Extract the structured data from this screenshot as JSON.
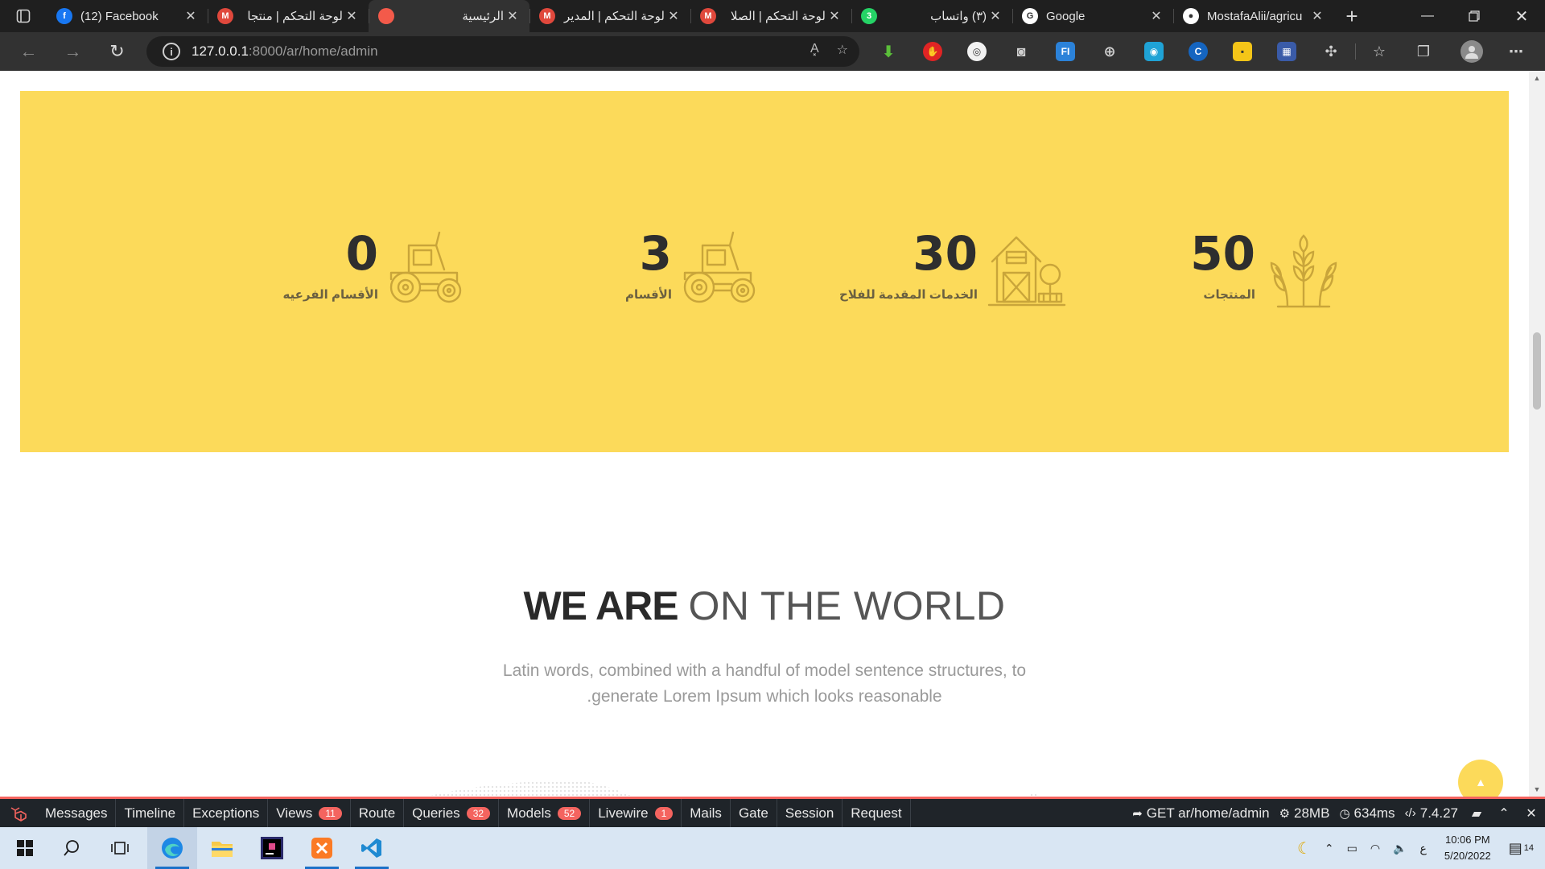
{
  "browser": {
    "tabs": [
      {
        "title": "(12) Facebook",
        "icon": "facebook-icon",
        "rtl": false,
        "active": false,
        "color": "#1877f2",
        "glyph": "f"
      },
      {
        "title": "لوحة التحكم | منتجا",
        "icon": "m-logo-icon",
        "rtl": true,
        "active": false,
        "color": "#e0483c",
        "glyph": "M"
      },
      {
        "title": "الرئيسية",
        "icon": "red-circle-icon",
        "rtl": true,
        "active": true,
        "color": "#f35a4a",
        "glyph": ""
      },
      {
        "title": "لوحة التحكم | المدير",
        "icon": "m-logo-icon",
        "rtl": true,
        "active": false,
        "color": "#e0483c",
        "glyph": "M"
      },
      {
        "title": "لوحة التحكم | الصلا",
        "icon": "m-logo-icon",
        "rtl": true,
        "active": false,
        "color": "#e0483c",
        "glyph": "M"
      },
      {
        "title": "(٣) واتساب",
        "icon": "whatsapp-icon",
        "rtl": true,
        "active": false,
        "color": "#25d366",
        "glyph": "3"
      },
      {
        "title": "Google",
        "icon": "google-icon",
        "rtl": false,
        "active": false,
        "color": "#ffffff",
        "glyph": "G"
      },
      {
        "title": "MostafaAlii/agricu",
        "icon": "github-icon",
        "rtl": false,
        "active": false,
        "color": "#ffffff",
        "glyph": "●"
      }
    ],
    "close_glyph": "✕",
    "new_tab_glyph": "+",
    "url_host": "127.0.0.1",
    "url_path": ":8000/ar/home/admin",
    "read_aloud_glyph": "A͓",
    "info_glyph": "i"
  },
  "stats": [
    {
      "number": "50",
      "label": "المنتجات",
      "icon": "wheat-icon"
    },
    {
      "number": "30",
      "label": "الخدمات المقدمة للفلاح",
      "icon": "farm-barn-icon"
    },
    {
      "number": "3",
      "label": "الأقسام",
      "icon": "tractor-icon"
    },
    {
      "number": "0",
      "label": "الأقسام الفرعيه",
      "icon": "tractor-icon"
    }
  ],
  "world": {
    "title_bold": "WE ARE",
    "title_light": "ON THE WORLD",
    "description": "Latin words, combined with a handful of model sentence structures, to generate Lorem Ipsum which looks reasonable."
  },
  "debugbar": {
    "tabs": [
      {
        "label": "Messages",
        "badge": ""
      },
      {
        "label": "Timeline",
        "badge": ""
      },
      {
        "label": "Exceptions",
        "badge": ""
      },
      {
        "label": "Views",
        "badge": "11"
      },
      {
        "label": "Route",
        "badge": ""
      },
      {
        "label": "Queries",
        "badge": "32"
      },
      {
        "label": "Models",
        "badge": "52"
      },
      {
        "label": "Livewire",
        "badge": "1"
      },
      {
        "label": "Mails",
        "badge": ""
      },
      {
        "label": "Gate",
        "badge": ""
      },
      {
        "label": "Session",
        "badge": ""
      },
      {
        "label": "Request",
        "badge": ""
      }
    ],
    "request": "GET ar/home/admin",
    "memory": "28MB",
    "time": "634ms",
    "php_version": "7.4.27",
    "accent": "#f4645f"
  },
  "taskbar": {
    "time": "10:06 PM",
    "date": "5/20/2022",
    "lang": "ع",
    "notifications": "14"
  },
  "colors": {
    "stats_bg": "#fcda5a",
    "icon_stroke": "#c9a53a"
  }
}
